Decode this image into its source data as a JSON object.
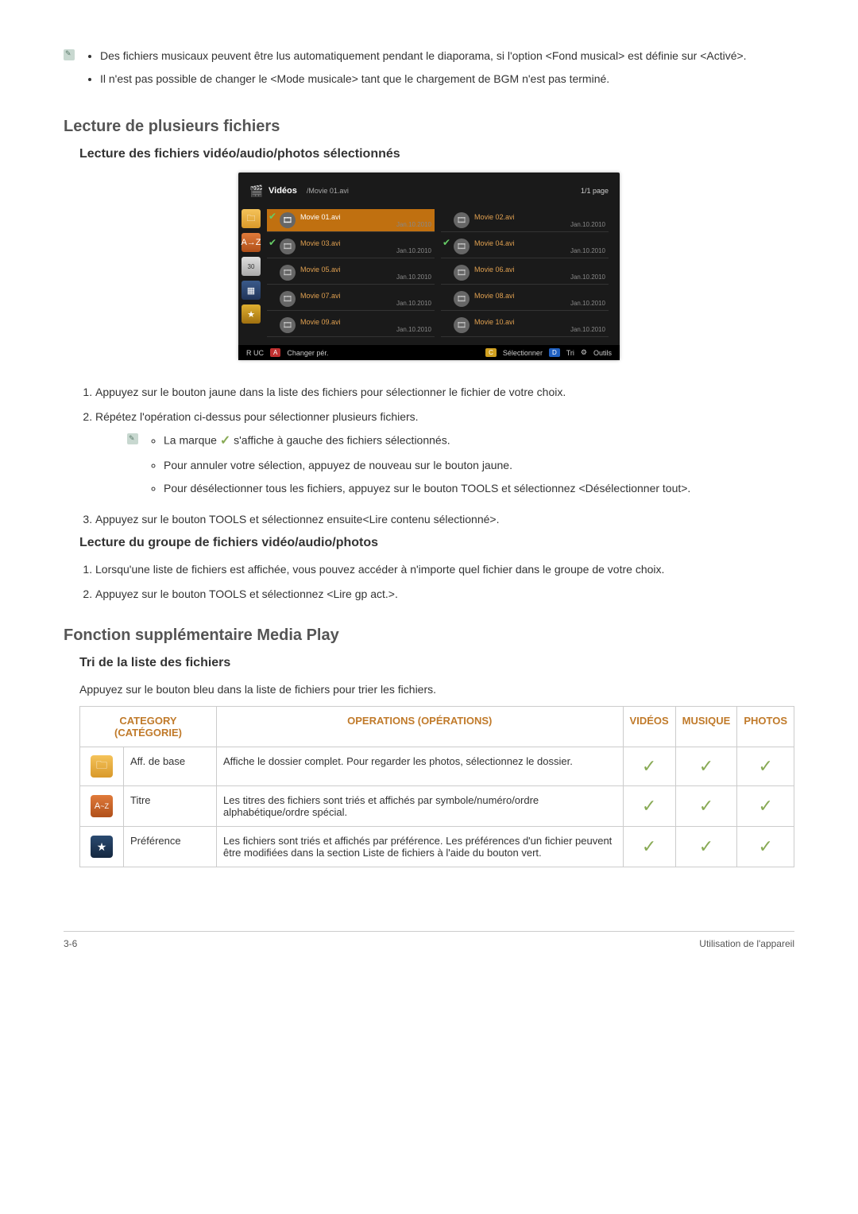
{
  "intro_notes": [
    "Des fichiers musicaux peuvent être lus automatiquement pendant le diaporama, si l'option <Fond musical> est définie sur <Activé>.",
    "Il n'est pas possible de changer le <Mode musicale> tant que le chargement de BGM n'est pas terminé."
  ],
  "section1": {
    "title": "Lecture de plusieurs fichiers",
    "sub1": "Lecture des fichiers vidéo/audio/photos sélectionnés",
    "sub2": "Lecture du groupe de fichiers vidéo/audio/photos"
  },
  "screenshot": {
    "header_label": "Vidéos",
    "breadcrumb": "/Movie 01.avi",
    "page": "1/1 page",
    "files": [
      {
        "name": "Movie 01.avi",
        "date": "Jan.10.2010",
        "selected": true,
        "checked": true
      },
      {
        "name": "Movie 02.avi",
        "date": "Jan.10.2010",
        "selected": false,
        "checked": false
      },
      {
        "name": "Movie 03.avi",
        "date": "Jan.10.2010",
        "selected": false,
        "checked": true
      },
      {
        "name": "Movie 04.avi",
        "date": "Jan.10.2010",
        "selected": false,
        "checked": true
      },
      {
        "name": "Movie 05.avi",
        "date": "Jan.10.2010",
        "selected": false,
        "checked": false
      },
      {
        "name": "Movie 06.avi",
        "date": "Jan.10.2010",
        "selected": false,
        "checked": false
      },
      {
        "name": "Movie 07.avi",
        "date": "Jan.10.2010",
        "selected": false,
        "checked": false
      },
      {
        "name": "Movie 08.avi",
        "date": "Jan.10.2010",
        "selected": false,
        "checked": false
      },
      {
        "name": "Movie 09.avi",
        "date": "Jan.10.2010",
        "selected": false,
        "checked": false
      },
      {
        "name": "Movie 10.avi",
        "date": "Jan.10.2010",
        "selected": false,
        "checked": false
      }
    ],
    "footer": {
      "uc": "R UC",
      "changer": "Changer pér.",
      "select": "Sélectionner",
      "tri": "Tri",
      "outils": "Outils"
    }
  },
  "steps_selected": [
    "Appuyez sur le bouton jaune dans la liste des fichiers pour sélectionner le fichier de votre choix.",
    "Répétez l'opération ci-dessus pour sélectionner plusieurs fichiers."
  ],
  "step2_notes": [
    "La marque ✓ s'affiche à gauche des fichiers sélectionnés.",
    "Pour annuler votre sélection, appuyez de nouveau sur le bouton jaune.",
    "Pour désélectionner tous les fichiers, appuyez sur le bouton TOOLS et sélectionnez <Désélectionner tout>."
  ],
  "step3": "Appuyez sur le bouton TOOLS et sélectionnez ensuite<Lire contenu sélectionné>.",
  "steps_group": [
    "Lorsqu'une liste de fichiers est affichée, vous pouvez accéder à n'importe quel fichier dans le groupe de votre choix.",
    "Appuyez sur le bouton TOOLS et sélectionnez <Lire gp act.>."
  ],
  "section2": {
    "title": "Fonction supplémentaire Media Play",
    "sub": "Tri de la liste des fichiers",
    "intro": "Appuyez sur le bouton bleu dans la liste de fichiers pour trier les fichiers."
  },
  "table": {
    "headers": {
      "cat": "CATEGORY (CATÉGORIE)",
      "ops": "OPERATIONS (OPÉRATIONS)",
      "v": "VIDÉOS",
      "m": "MUSIQUE",
      "p": "PHOTOS"
    },
    "rows": [
      {
        "icon": "folder",
        "name": "Aff. de base",
        "ops": "Affiche le dossier complet. Pour regarder les photos, sélectionnez le dossier.",
        "v": true,
        "m": true,
        "p": true
      },
      {
        "icon": "az",
        "name": "Titre",
        "ops": "Les titres des fichiers sont triés et affichés par symbole/numéro/ordre alphabétique/ordre spécial.",
        "v": true,
        "m": true,
        "p": true
      },
      {
        "icon": "star",
        "name": "Préférence",
        "ops": "Les fichiers sont triés et affichés par préférence. Les préférences d'un fichier peuvent être modifiées dans la section Liste de fichiers à l'aide du bouton vert.",
        "v": true,
        "m": true,
        "p": true
      }
    ]
  },
  "footer": {
    "left": "3-6",
    "right": "Utilisation de l'appareil"
  }
}
